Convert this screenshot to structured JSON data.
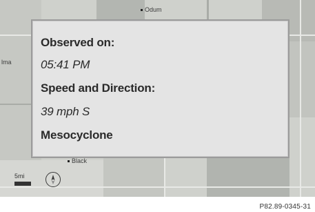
{
  "map": {
    "city_top": "Odum",
    "city_left": "lma",
    "city_bottom": "Black"
  },
  "popup": {
    "observed_label": "Observed on:",
    "observed_value": "05:41 PM",
    "speed_label": "Speed and Direction:",
    "speed_value": "39 mph S",
    "type_label": "Mesocyclone"
  },
  "scale": {
    "label": "5mi"
  },
  "compass": {
    "icon": "compass-icon"
  },
  "footer": {
    "code": "P82.89-0345-31"
  }
}
